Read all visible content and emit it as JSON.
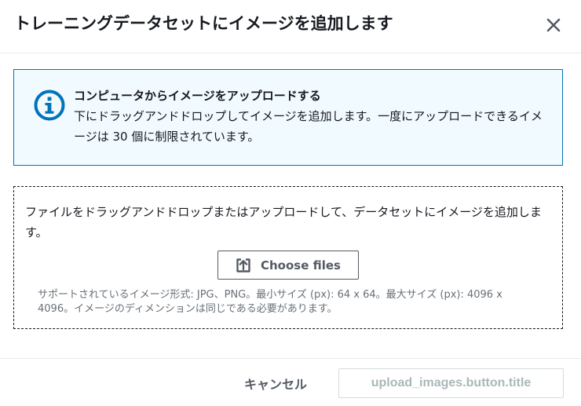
{
  "dialog": {
    "title": "トレーニングデータセットにイメージを追加します"
  },
  "info_alert": {
    "title": "コンピュータからイメージをアップロードする",
    "body": "下にドラッグアンドドロップしてイメージを追加します。一度にアップロードできるイメージは 30 個に制限されています。"
  },
  "dropzone": {
    "text": "ファイルをドラッグアンドドロップまたはアップロードして、データセットにイメージを追加します。",
    "choose_label": "Choose files",
    "hint": "サポートされているイメージ形式: JPG、PNG。最小サイズ (px): 64 x 64。最大サイズ (px): 4096 x 4096。イメージのディメンションは同じである必要があります。"
  },
  "footer": {
    "cancel_label": "キャンセル",
    "upload_label": "upload_images.button.title"
  },
  "colors": {
    "info_border": "#0073bb",
    "info_background": "#f1faff",
    "text": "#16191f",
    "button_text": "#545b64",
    "disabled_text": "#aab7b8"
  },
  "icons": {
    "close": "close-icon",
    "info": "info-icon",
    "upload": "upload-icon"
  }
}
